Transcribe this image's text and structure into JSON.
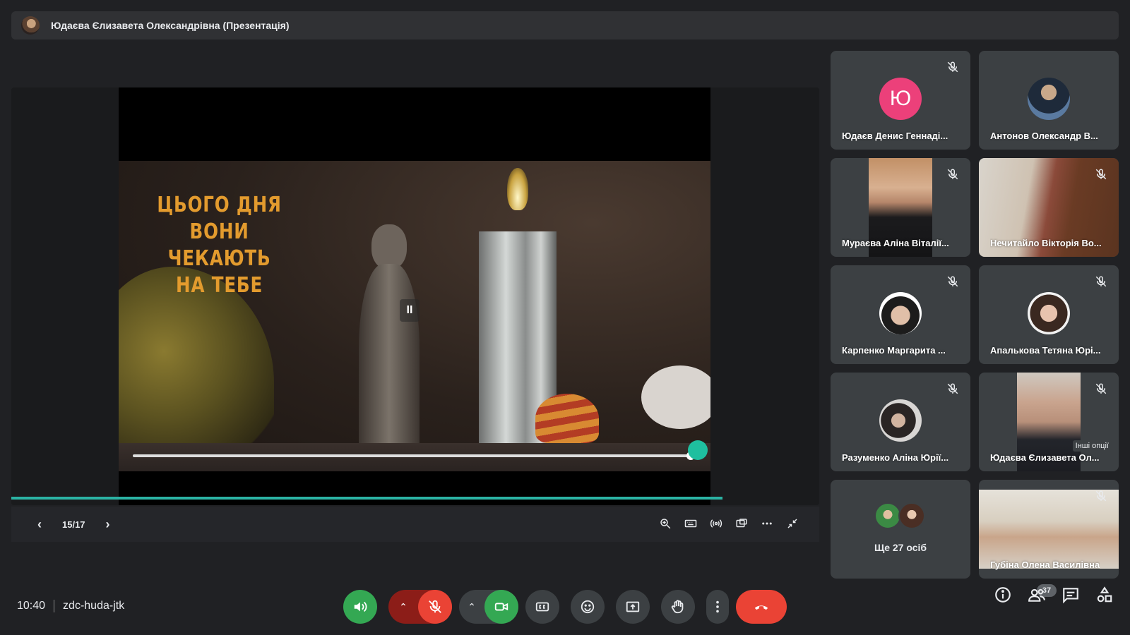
{
  "presenter": {
    "title": "Юдаєва Єлизавета Олександрівна (Презентація)"
  },
  "slide": {
    "slogan": [
      "ЦЬОГО ДНЯ",
      "ВОНИ ЧЕКАЮТЬ",
      "НА ТЕБЕ"
    ],
    "pause_glyph": "II",
    "counter": "15/17",
    "current": 15,
    "total": 17,
    "video_progress": 0.99,
    "slide_progress": 0.88
  },
  "participants": [
    {
      "name": "Юдаєв Денис Геннаді...",
      "type": "initial",
      "initial": "Ю"
    },
    {
      "name": "Антонов Олександр В...",
      "type": "avatar"
    },
    {
      "name": "Мураєва Аліна Віталії...",
      "type": "video"
    },
    {
      "name": "Нечитайло Вікторія Во...",
      "type": "video"
    },
    {
      "name": "Карпенко Маргарита ...",
      "type": "avatar"
    },
    {
      "name": "Апалькова Тетяна Юрі...",
      "type": "avatar"
    },
    {
      "name": "Разуменко Аліна Юрії...",
      "type": "avatar"
    },
    {
      "name": "Юдаєва Єлизавета Ол...",
      "type": "video",
      "tooltip": "Інші опції"
    },
    {
      "name": "Ще 27 осіб",
      "type": "more"
    },
    {
      "name": "Губіна Олена Василівна",
      "type": "video"
    }
  ],
  "meeting": {
    "time": "10:40",
    "code": "zdc-huda-jtk",
    "people_count": "37"
  },
  "colors": {
    "accent": "#2bb3a4",
    "end_call": "#ea4335",
    "mic_off": "#ea4335",
    "camera_on": "#34a853",
    "speaking": "#34a853"
  }
}
